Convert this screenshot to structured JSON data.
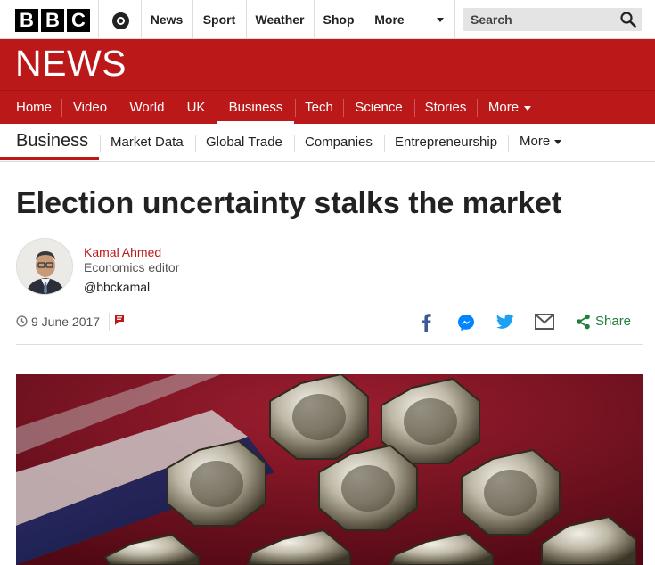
{
  "brand": {
    "logo_letters": [
      "B",
      "B",
      "C"
    ],
    "section_wordmark": "NEWS"
  },
  "top_nav": {
    "items": [
      "News",
      "Sport",
      "Weather",
      "Shop",
      "More"
    ],
    "search_placeholder": "Search"
  },
  "red_nav": {
    "items": [
      "Home",
      "Video",
      "World",
      "UK",
      "Business",
      "Tech",
      "Science",
      "Stories",
      "More"
    ],
    "active": "Business"
  },
  "sub_nav": {
    "title": "Business",
    "items": [
      "Market Data",
      "Global Trade",
      "Companies",
      "Entrepreneurship",
      "More"
    ]
  },
  "article": {
    "headline": "Election uncertainty stalks the market",
    "author": {
      "name": "Kamal Ahmed",
      "role": "Economics editor",
      "handle": "@bbckamal"
    },
    "date": "9 June 2017",
    "share_label": "Share"
  },
  "colors": {
    "brand_red": "#bb1919",
    "share_green": "#1f7f3a",
    "facebook": "#3b5998",
    "messenger": "#0084ff",
    "twitter": "#1da1f2"
  },
  "icons": [
    "account-icon",
    "chevron-down-icon",
    "search-icon",
    "clock-icon",
    "comment-icon",
    "facebook-icon",
    "messenger-icon",
    "twitter-icon",
    "email-icon",
    "share-icon"
  ]
}
